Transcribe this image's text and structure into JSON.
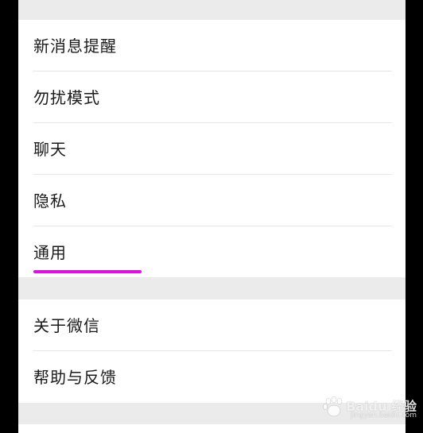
{
  "settings": {
    "group1": [
      {
        "label": "新消息提醒"
      },
      {
        "label": "勿扰模式"
      },
      {
        "label": "聊天"
      },
      {
        "label": "隐私"
      },
      {
        "label": "通用"
      }
    ],
    "group2": [
      {
        "label": "关于微信"
      },
      {
        "label": "帮助与反馈"
      }
    ]
  },
  "annotation": {
    "underline_color": "#e10ee6"
  },
  "watermark": {
    "brand": "Baidu",
    "text": "经验",
    "url": "jingyan.baidu.com"
  }
}
